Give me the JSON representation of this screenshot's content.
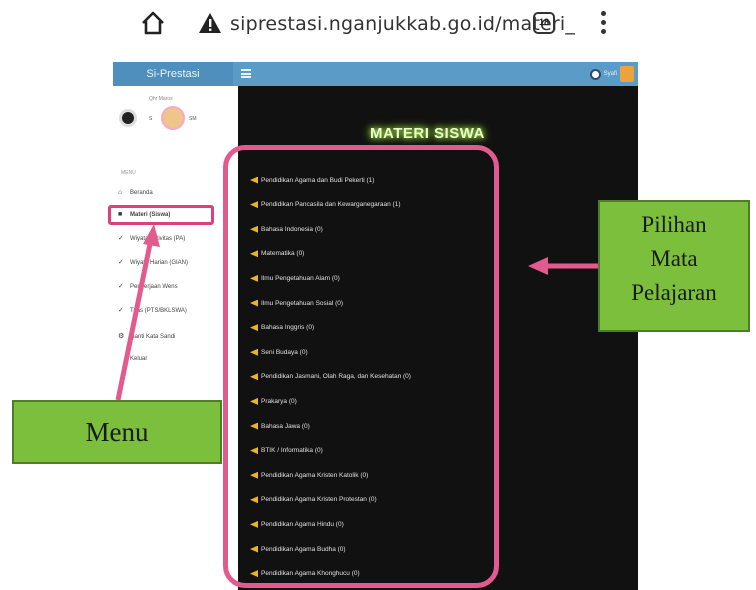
{
  "browser": {
    "url": "siprestasi.nganjukkab.go.id/materi_",
    "tab_count": "18",
    "icons": {
      "home": "home-icon",
      "security": "warning-icon",
      "tabs": "tabs-icon",
      "menu": "more-vert-icon"
    }
  },
  "app": {
    "brand": "Si-Prestasi",
    "header_color": "#5a9bc8",
    "user_name": "Syafi"
  },
  "sidebar": {
    "greeting": "Qhr Maros",
    "user_name": "S",
    "user_role": "SM",
    "menu_heading": "MENU",
    "items": [
      {
        "icon": "home-icon",
        "label": "Beranda",
        "active": false
      },
      {
        "icon": "folder-icon",
        "label": "Materi (Siswa)",
        "active": true
      },
      {
        "icon": "check-icon",
        "label": "Wiyata Aktivitas (PA)",
        "active": false
      },
      {
        "icon": "check-icon",
        "label": "Wiyata Harian (GIAN)",
        "active": false
      },
      {
        "icon": "check-icon",
        "label": "Pengerjaan Wens",
        "active": false
      },
      {
        "icon": "check-icon",
        "label": "Tuas (PTS/BKLSWA)",
        "active": false
      },
      {
        "icon": "settings-icon",
        "label": "Ganti Kata Sandi",
        "active": false
      },
      {
        "icon": "",
        "label": "Keluar",
        "active": false
      }
    ]
  },
  "main": {
    "title": "MATERI SISWA",
    "background": "#111111",
    "subjects": [
      "Pendidikan Agama dan Budi Pekerti (1)",
      "Pendidikan Pancasila dan Kewarganegaraan (1)",
      "Bahasa Indonesia (0)",
      "Matematika (0)",
      "Ilmu Pengetahuan Alam (0)",
      "Ilmu Pengetahuan Sosial (0)",
      "Bahasa Inggris (0)",
      "Seni Budaya (0)",
      "Pendidikan Jasmani, Olah Raga, dan Kesehatan (0)",
      "Prakarya (0)",
      "Bahasa Jawa (0)",
      "BTIK / Informatika (0)",
      "Pendidikan Agama Kristen Katolik (0)",
      "Pendidikan Agama Kristen Protestan (0)",
      "Pendidikan Agama Hindu (0)",
      "Pendidikan Agama Budha (0)",
      "Pendidikan Agama Khonghucu (0)"
    ]
  },
  "annotations": {
    "pilihan_lines": [
      "Pilihan",
      "Mata",
      "Pelajaran"
    ],
    "menu_label": "Menu",
    "callout_color": "#7bbf3d",
    "arrow_color": "#e35a8e"
  }
}
